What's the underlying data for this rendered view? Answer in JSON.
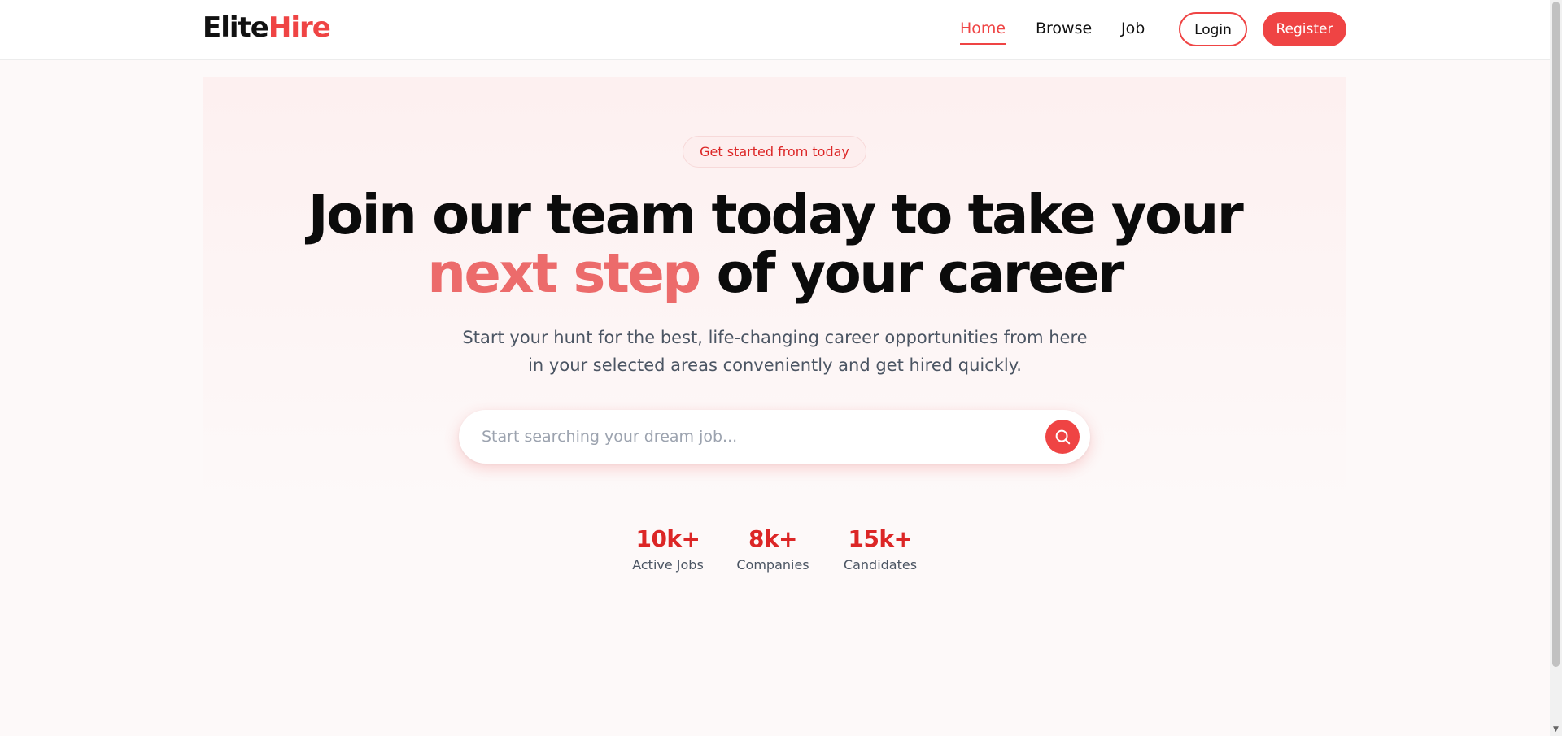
{
  "header": {
    "logo": {
      "part1": "Elite",
      "part2": "Hire"
    },
    "nav": [
      {
        "label": "Home",
        "active": true
      },
      {
        "label": "Browse",
        "active": false
      },
      {
        "label": "Job",
        "active": false
      }
    ],
    "login_label": "Login",
    "register_label": "Register"
  },
  "hero": {
    "badge": "Get started from today",
    "headline_line1": "Join our team today to take your",
    "headline_accent": "next step",
    "headline_rest": " of your career",
    "subtext_line1": "Start your hunt for the best, life-changing career opportunities from here",
    "subtext_line2": "in your selected areas conveniently and get hired quickly."
  },
  "search": {
    "placeholder": "Start searching your dream job...",
    "value": "",
    "icon": "search-icon"
  },
  "stats": [
    {
      "value": "10k+",
      "label": "Active Jobs"
    },
    {
      "value": "8k+",
      "label": "Companies"
    },
    {
      "value": "15k+",
      "label": "Candidates"
    }
  ],
  "colors": {
    "accent": "#ef4444",
    "accent_soft": "#ec6b6b",
    "text_dark": "#0b0b0b",
    "text_muted": "#4b5563"
  }
}
